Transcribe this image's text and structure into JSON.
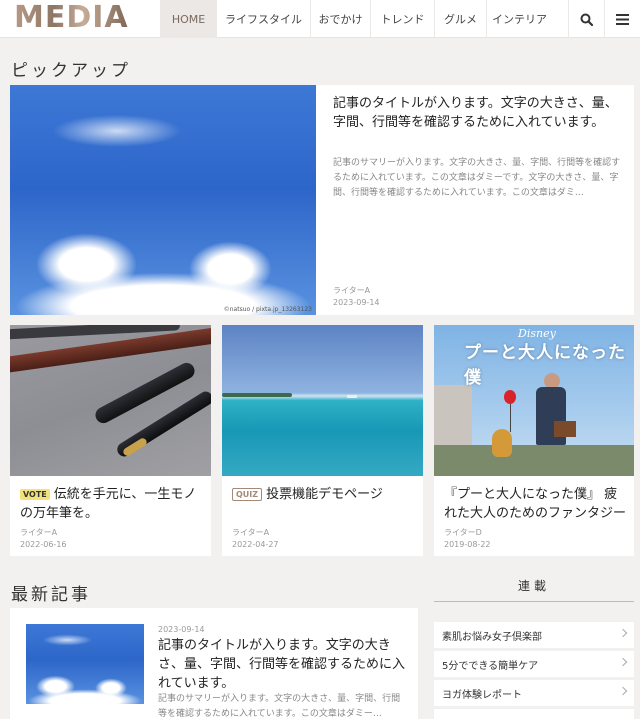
{
  "header": {
    "logo": "MEDIA",
    "nav": [
      "HOME",
      "ライフスタイル",
      "おでかけ",
      "トレンド",
      "グルメ",
      "インテリア"
    ],
    "active_index": 0
  },
  "pickup": {
    "title": "ピックアップ",
    "featured": {
      "title": "記事のタイトルが入ります。文字の大きさ、量、字間、行間等を確認するために入れています。",
      "summary": "記事のサマリーが入ります。文字の大きさ、量、字間、行間等を確認するために入れています。この文章はダミーです。文字の大きさ、量、字間、行間等を確認するために入れています。この文章はダミ…",
      "author": "ライターA",
      "date": "2023-09-14",
      "image_credit": "©natsuo / pixta.jp_13263123"
    },
    "cards": [
      {
        "badge": "VOTE",
        "title": "伝統を手元に、一生モノの万年筆を。",
        "author": "ライターA",
        "date": "2022-06-16",
        "image": "fountain-pen-photo"
      },
      {
        "badge": "QUIZ",
        "title": "投票機能デモページ",
        "author": "ライターA",
        "date": "2022-04-27",
        "image": "ocean-photo"
      },
      {
        "badge": "",
        "title": "『プーと大人になった僕』 疲れた大人のためのファンタジー",
        "author": "ライターD",
        "date": "2019-08-22",
        "image": "movie-poster",
        "poster_brand": "Disney",
        "poster_title": "プーと大人になった僕"
      }
    ]
  },
  "latest": {
    "title": "最新記事",
    "item": {
      "date": "2023-09-14",
      "title": "記事のタイトルが入ります。文字の大きさ、量、字間、行間等を確認するために入れています。",
      "summary": "記事のサマリーが入ります。文字の大きさ、量、字間、行間等を確認するために入れています。この文章はダミー…"
    }
  },
  "sidebar": {
    "title": "連載",
    "items": [
      "素肌お悩み女子倶楽部",
      "5分でできる簡単ケア",
      "ヨガ体験レポート"
    ]
  },
  "colors": {
    "accent": "#a38a78",
    "badge_vote_bg": "#f3e27a",
    "badge_quiz_border": "#a38a78"
  }
}
